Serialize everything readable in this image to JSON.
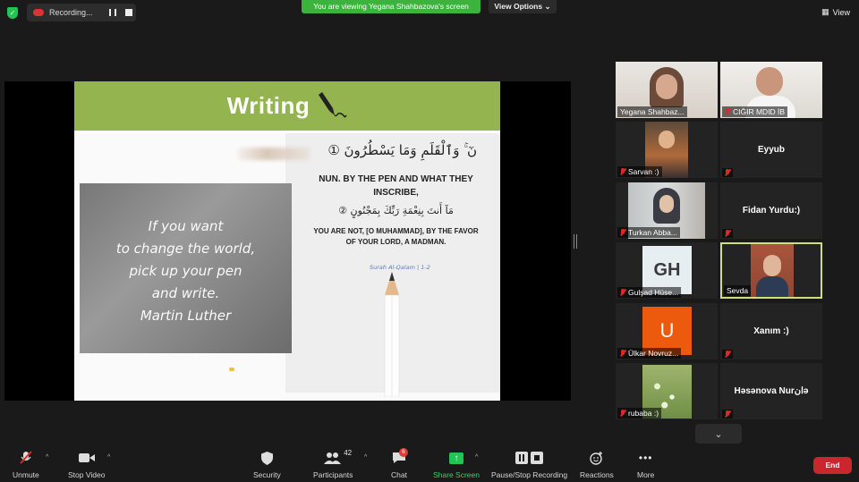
{
  "top_bar": {
    "recording_label": "Recording...",
    "viewing_banner": "You are viewing Yegana Shahbazova's screen",
    "view_options_label": "View Options",
    "view_label": "View"
  },
  "slide": {
    "title": "Writing",
    "arabic_verse_1": "نٓ ۚ وَٱلْقَلَمِ وَمَا يَسْطُرُونَ ①",
    "english_1": "NUN. BY THE PEN AND WHAT THEY INSCRIBE,",
    "arabic_verse_2": "مَآ أَنتَ بِنِعْمَةِ رَبِّكَ بِمَجْنُونٍ ②",
    "english_2": "YOU ARE NOT, [O MUHAMMAD], BY THE FAVOR OF YOUR LORD, A MADMAN.",
    "surah_ref": "Surah Al-Qalam | 1-2",
    "quote_lines": [
      "If you want",
      "to change the world,",
      "pick up your pen",
      "and write.",
      "Martin Luther"
    ]
  },
  "participants": [
    {
      "name": "Yegana Shahbaz...",
      "muted": false
    },
    {
      "name": "CIĞIR MDID İB",
      "muted": true
    },
    {
      "name": "Sarvan :)",
      "muted": true
    },
    {
      "name": "Eyyub",
      "muted": true
    },
    {
      "name": "Turkan Abba...",
      "muted": true
    },
    {
      "name": "Fidan Yurdu:)",
      "muted": true
    },
    {
      "name": "Gulşad Hüse...",
      "muted": true,
      "initials": "GH"
    },
    {
      "name": "Sevda",
      "muted": false
    },
    {
      "name": "Ülkar Novruz...",
      "muted": true,
      "initials": "U"
    },
    {
      "name": "Xanım :)",
      "muted": true
    },
    {
      "name": "rubaba :)",
      "muted": true
    },
    {
      "name": "Həsənova Nurانə",
      "muted": true
    }
  ],
  "toolbar": {
    "unmute": "Unmute",
    "stop_video": "Stop Video",
    "security": "Security",
    "participants": "Participants",
    "participants_count": "42",
    "chat": "Chat",
    "chat_badge": "6",
    "share_screen": "Share Screen",
    "pause_stop_recording": "Pause/Stop Recording",
    "reactions": "Reactions",
    "more": "More",
    "end": "End"
  },
  "colors": {
    "slide_header": "#93b44e",
    "banner_green": "#3cb33c",
    "end_red": "#c9262d",
    "active_speaker": "#cfe07a"
  }
}
